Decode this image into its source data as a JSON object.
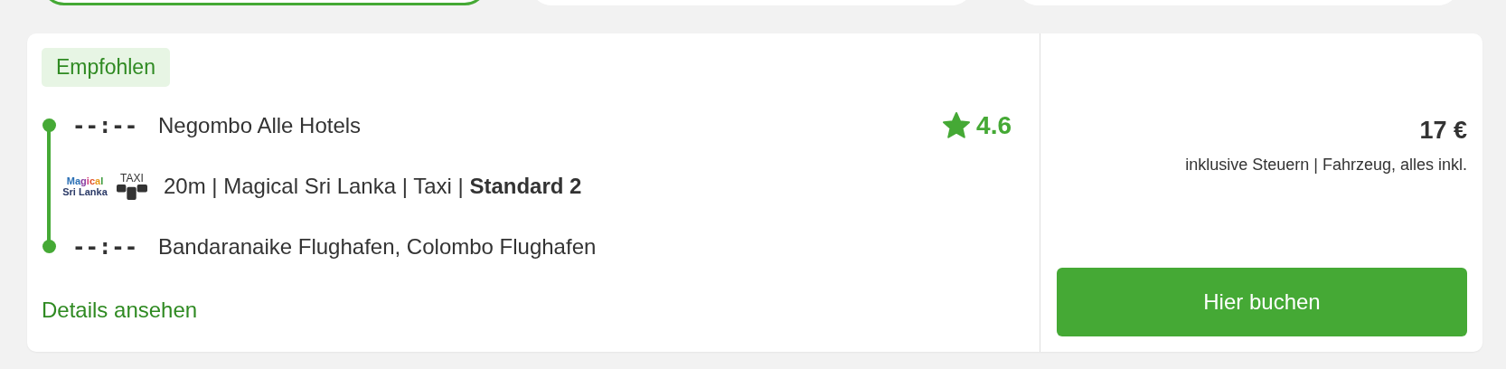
{
  "filter_tabs": [
    {
      "selected": true
    },
    {
      "selected": false
    },
    {
      "selected": false
    }
  ],
  "offer": {
    "badge": "Empfohlen",
    "route": [
      {
        "kind": "stop",
        "time": "--:--",
        "place": "Negombo Alle Hotels"
      },
      {
        "kind": "ride",
        "logo_line_1": "Magical",
        "logo_line_2": "Sri Lanka",
        "vehicle_label": "TAXI",
        "details": "20m | Magical Sri Lanka | Taxi | **Standard 2**"
      },
      {
        "kind": "stop",
        "time": "--:--",
        "place": "Bandaranaike Flughafen, Colombo Flughafen"
      }
    ],
    "rating": {
      "value": "4.6"
    },
    "details_link": "Details ansehen",
    "price": "17 €",
    "price_note": "inklusive Steuern | Fahrzeug, alles inkl.",
    "book_button": "Hier buchen"
  }
}
